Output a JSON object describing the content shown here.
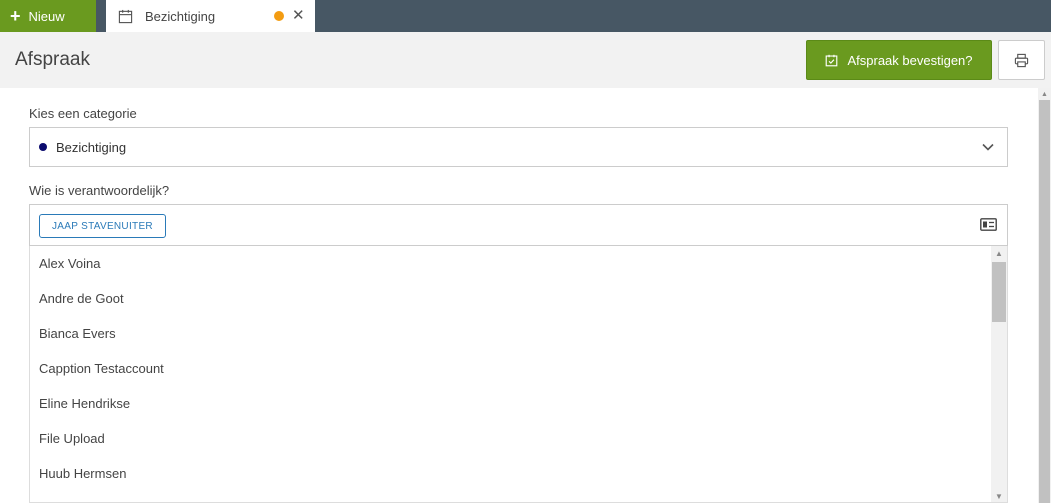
{
  "topbar": {
    "new_label": "Nieuw",
    "tab": {
      "label": "Bezichtiging"
    }
  },
  "header": {
    "title": "Afspraak",
    "confirm_label": "Afspraak bevestigen?"
  },
  "form": {
    "category_label": "Kies een categorie",
    "category_value": "Bezichtiging",
    "responsible_label": "Wie is verantwoordelijk?",
    "responsible_chip": "JAAP STAVENUITER"
  },
  "dropdown": {
    "items": [
      "Alex Voina",
      "Andre de Goot",
      "Bianca Evers",
      "Capption Testaccount",
      "Eline Hendrikse",
      "File Upload",
      "Huub Hermsen"
    ]
  },
  "colors": {
    "accent_green": "#6a9a1f",
    "topbar": "#475764",
    "unsaved_dot": "#f39c12",
    "category_bullet": "#0b0b6e",
    "chip_blue": "#2a7ab8"
  }
}
